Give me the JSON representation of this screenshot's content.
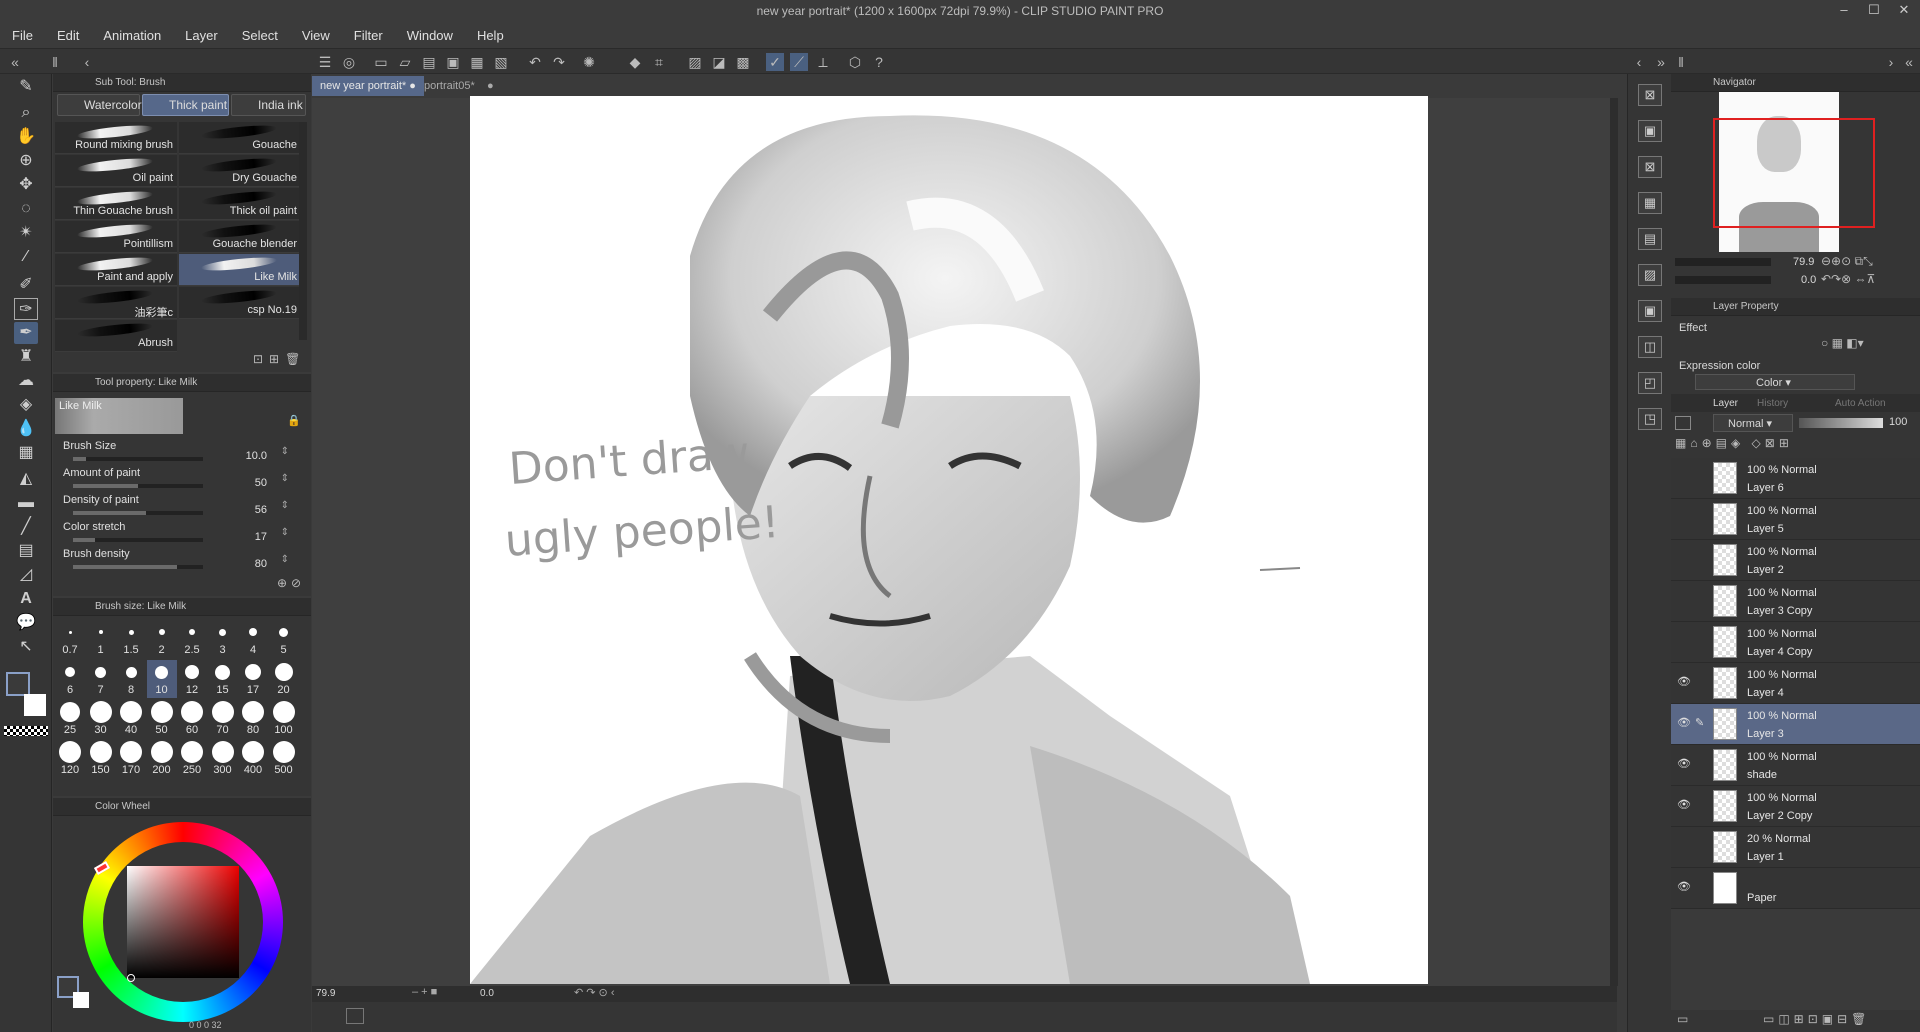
{
  "window": {
    "title": "new year portrait* (1200 x 1600px 72dpi 79.9%) - CLIP STUDIO PAINT PRO"
  },
  "menu": [
    "File",
    "Edit",
    "Animation",
    "Layer",
    "Select",
    "View",
    "Filter",
    "Window",
    "Help"
  ],
  "subtool": {
    "header": "Sub Tool: Brush",
    "tabs": [
      "Watercolor",
      "Thick paint",
      "India ink"
    ],
    "active_tab": "Thick paint",
    "brushes": [
      {
        "name": "Round mixing brush",
        "dark": false
      },
      {
        "name": "Gouache",
        "dark": true
      },
      {
        "name": "Oil paint",
        "dark": false
      },
      {
        "name": "Dry Gouache",
        "dark": true
      },
      {
        "name": "Thin Gouache brush",
        "dark": false
      },
      {
        "name": "Thick oil paint",
        "dark": true
      },
      {
        "name": "Pointillism",
        "dark": false
      },
      {
        "name": "Gouache blender",
        "dark": true
      },
      {
        "name": "Paint and apply",
        "dark": false
      },
      {
        "name": "Like Milk",
        "dark": false,
        "selected": true
      },
      {
        "name": "油彩筆c",
        "dark": true
      },
      {
        "name": "csp No.19",
        "dark": true
      },
      {
        "name": "Abrush",
        "dark": true
      }
    ]
  },
  "tool_property": {
    "header": "Tool property: Like Milk",
    "preset_name": "Like Milk",
    "rows": [
      {
        "label": "Brush Size",
        "value": "10.0",
        "level": 0.1
      },
      {
        "label": "Amount of paint",
        "value": "50",
        "level": 0.5
      },
      {
        "label": "Density of paint",
        "value": "56",
        "level": 0.56
      },
      {
        "label": "Color stretch",
        "value": "17",
        "level": 0.17
      },
      {
        "label": "Brush density",
        "value": "80",
        "level": 0.8
      }
    ]
  },
  "brush_size": {
    "header": "Brush size: Like Milk",
    "sizes": [
      "0.7",
      "1",
      "1.5",
      "2",
      "2.5",
      "3",
      "4",
      "5",
      "6",
      "7",
      "8",
      "10",
      "12",
      "15",
      "17",
      "20",
      "25",
      "30",
      "40",
      "50",
      "60",
      "70",
      "80",
      "100",
      "120",
      "150",
      "170",
      "200",
      "250",
      "300",
      "400",
      "500"
    ],
    "selected": "10"
  },
  "color_wheel": {
    "header": "Color Wheel",
    "status": "0  0  0  32"
  },
  "documents": {
    "tabs": [
      "new year portrait*",
      "portrait05*"
    ],
    "active": "new year portrait*",
    "zoom": "79.9",
    "rotation": "0.0"
  },
  "canvas_text": {
    "line1": "Don't draw",
    "line2": "ugly people!"
  },
  "navigator": {
    "header": "Navigator",
    "zoom": "79.9",
    "rotation": "0.0"
  },
  "layer_property": {
    "header": "Layer Property",
    "effect_label": "Effect",
    "expression_label": "Expression color",
    "expression_value": "Color"
  },
  "layers_panel": {
    "tabs": [
      "Layer",
      "History",
      "Auto Action"
    ],
    "blend_mode": "Normal",
    "opacity": "100",
    "layers": [
      {
        "mode": "100 % Normal",
        "name": "Layer 6",
        "visible": false,
        "selected": false
      },
      {
        "mode": "100 % Normal",
        "name": "Layer 5",
        "visible": false,
        "selected": false
      },
      {
        "mode": "100 % Normal",
        "name": "Layer 2",
        "visible": false,
        "selected": false
      },
      {
        "mode": "100 % Normal",
        "name": "Layer 3 Copy",
        "visible": false,
        "selected": false
      },
      {
        "mode": "100 % Normal",
        "name": "Layer 4 Copy",
        "visible": false,
        "selected": false
      },
      {
        "mode": "100 % Normal",
        "name": "Layer 4",
        "visible": true,
        "selected": false
      },
      {
        "mode": "100 % Normal",
        "name": "Layer 3",
        "visible": true,
        "selected": true
      },
      {
        "mode": "100 % Normal",
        "name": "shade",
        "visible": true,
        "selected": false
      },
      {
        "mode": "100 % Normal",
        "name": "Layer 2 Copy",
        "visible": true,
        "selected": false
      },
      {
        "mode": "20 % Normal",
        "name": "Layer 1",
        "visible": false,
        "selected": false
      },
      {
        "mode": "",
        "name": "Paper",
        "visible": true,
        "selected": false
      }
    ]
  }
}
